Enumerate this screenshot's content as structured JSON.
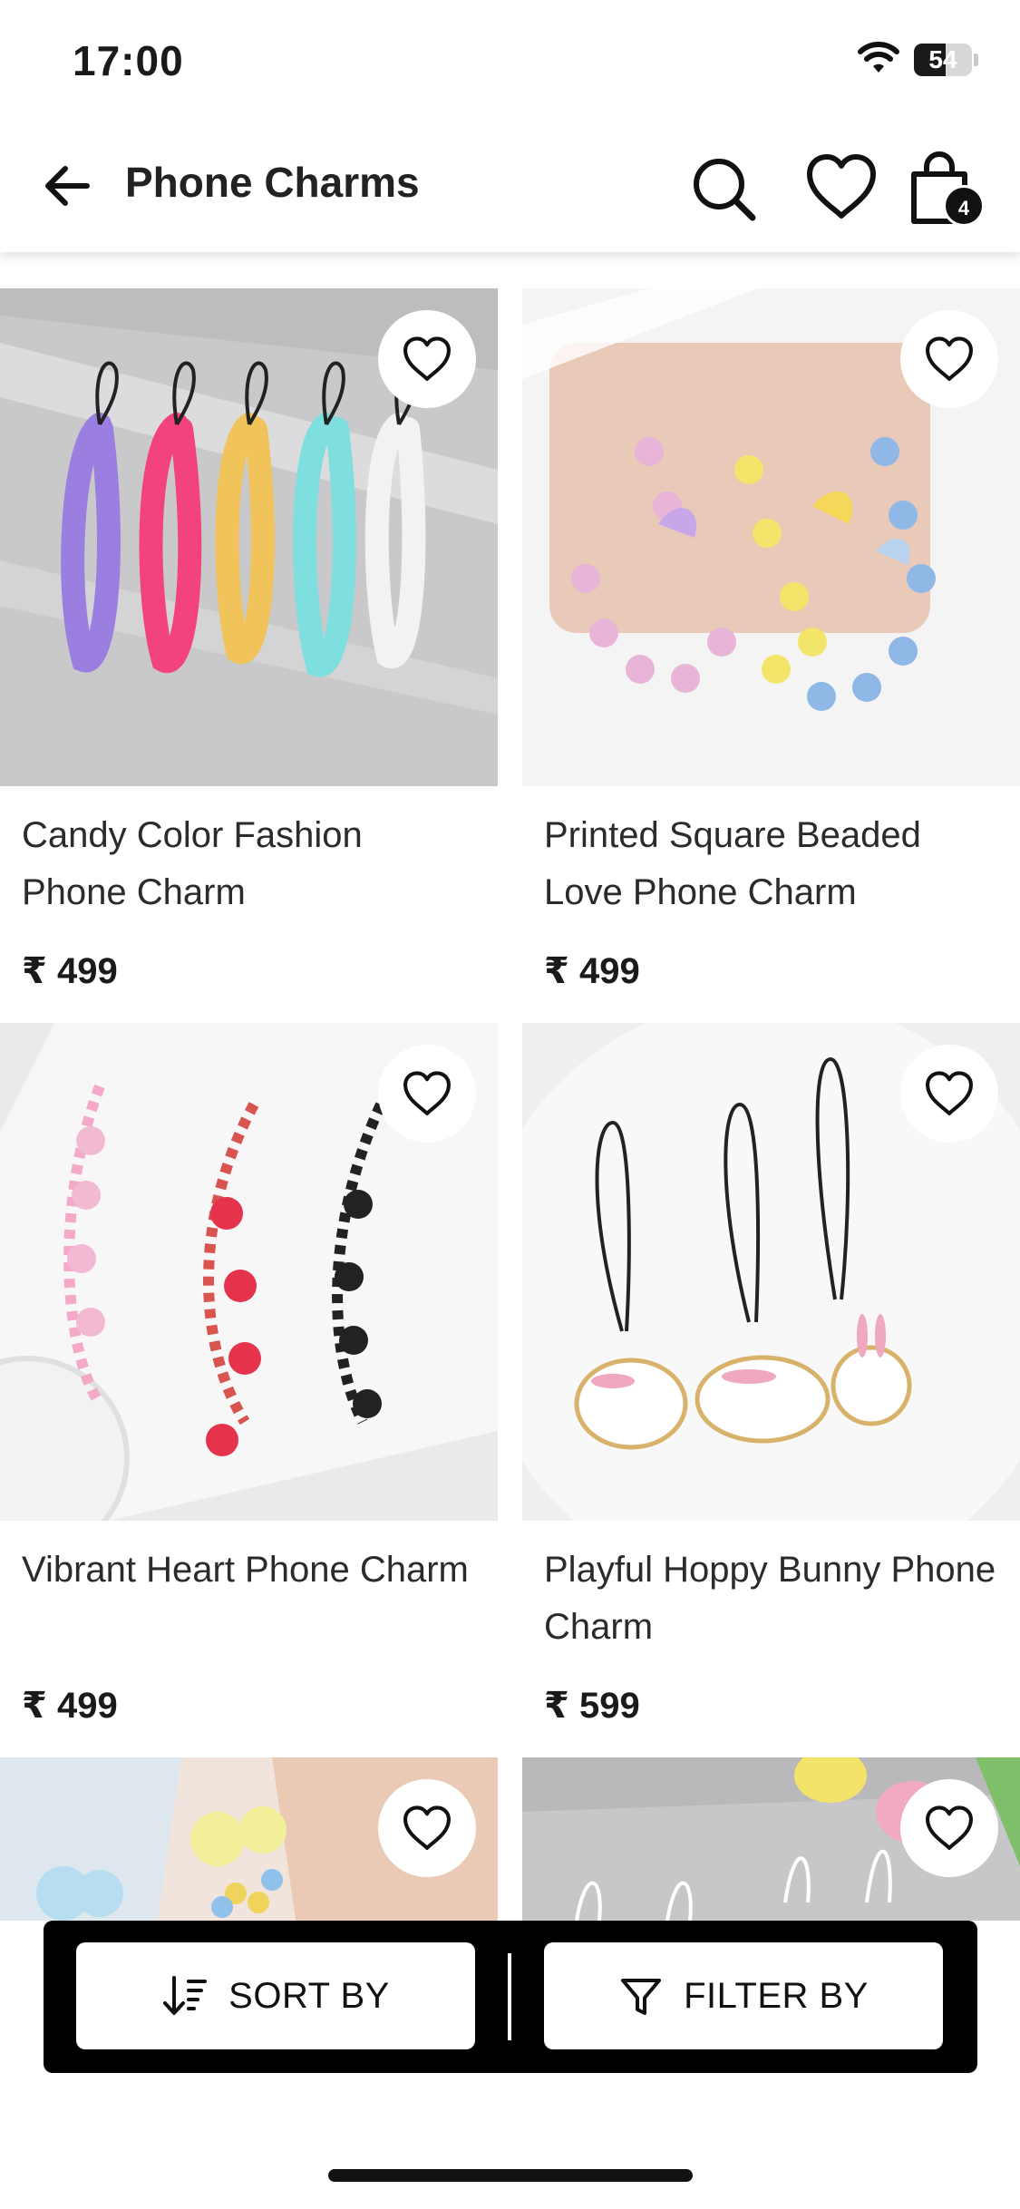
{
  "status_bar": {
    "time": "17:00",
    "battery": "54",
    "battery_level": 0.54
  },
  "header": {
    "title": "Phone Charms",
    "cart_count": "4",
    "icons": {
      "back": "arrow-left-icon",
      "search": "search-icon",
      "wishlist": "heart-icon",
      "cart": "shopping-bag-icon"
    }
  },
  "products": [
    {
      "name": "Candy Color Fashion Phone Charm",
      "price": "₹ 499"
    },
    {
      "name": "Printed Square Beaded Love Phone Charm",
      "price": "₹ 499"
    },
    {
      "name": "Vibrant Heart Phone Charm",
      "price": "₹ 499"
    },
    {
      "name": "Playful Hoppy Bunny Phone Charm",
      "price": "₹ 599"
    },
    {
      "name": "",
      "price": ""
    },
    {
      "name": "",
      "price": ""
    }
  ],
  "bottom_bar": {
    "sort_label": "SORT BY",
    "filter_label": "FILTER BY",
    "icons": {
      "sort": "sort-icon",
      "filter": "filter-icon"
    }
  },
  "colors": {
    "accent": "#000000",
    "background": "#ffffff"
  }
}
